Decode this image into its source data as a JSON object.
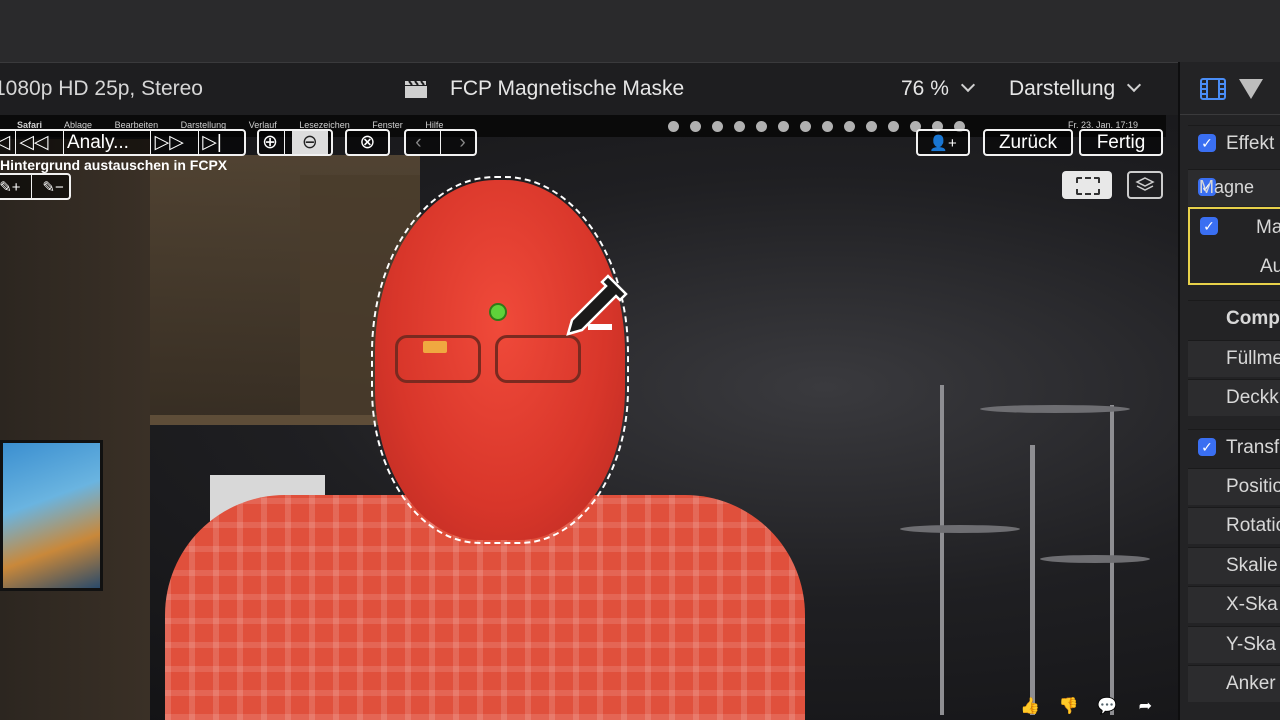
{
  "header": {
    "format": "1080p HD 25p, Stereo",
    "title": "FCP Magnetische Maske",
    "zoom": "76 %",
    "view": "Darstellung"
  },
  "menubar": {
    "items": [
      "Safari",
      "Ablage",
      "Bearbeiten",
      "Darstellung",
      "Verlauf",
      "Lesezeichen",
      "Fenster",
      "Hilfe"
    ],
    "clock": "Fr. 23. Jan. 17:19"
  },
  "toolbar": {
    "analyze": "Analy...",
    "back": "Zurück",
    "done": "Fertig"
  },
  "subtitle": "Hintergrund austauschen in FCPX",
  "inspector": {
    "rows": [
      {
        "label": "Effekt",
        "checked": true
      },
      {
        "label": "Magne",
        "checked": true
      },
      {
        "label": "Ma",
        "checked": true
      },
      {
        "label": "Au",
        "checked": false
      },
      {
        "label": "Comp",
        "checked": false
      },
      {
        "label": "Füllme",
        "checked": false
      },
      {
        "label": "Deckk",
        "checked": false
      },
      {
        "label": "Transf",
        "checked": true
      },
      {
        "label": "Positio",
        "checked": false
      },
      {
        "label": "Rotatio",
        "checked": false
      },
      {
        "label": "Skalie",
        "checked": false
      },
      {
        "label": "X-Ska",
        "checked": false
      },
      {
        "label": "Y-Ska",
        "checked": false
      },
      {
        "label": "Anker",
        "checked": false
      }
    ]
  },
  "icons": [
    "clapper-icon",
    "film-icon",
    "filter-icon",
    "zoom-in-icon",
    "zoom-out-icon",
    "clear-icon",
    "eyedropper-icon",
    "thumbs-up-icon",
    "thumbs-down-icon",
    "comment-icon",
    "share-icon"
  ]
}
